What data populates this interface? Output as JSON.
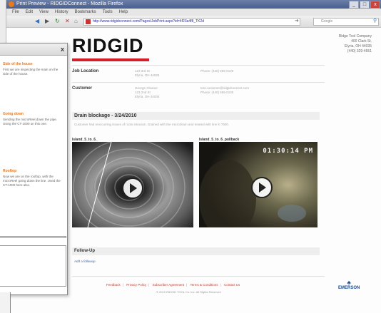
{
  "browser": {
    "title": "Print Preview - RIDGIDConnect - Mozilla Firefox",
    "menu": [
      "File",
      "Edit",
      "View",
      "History",
      "Bookmarks",
      "Tools",
      "Help"
    ],
    "url": "http://www.ridgidconnect.com/Pages/JobPrint.aspx?id=4f23a4f8_TK2d",
    "search_placeholder": "Google",
    "controls": {
      "minimize": "_",
      "maximize": "□",
      "close": "x"
    }
  },
  "page": {
    "logo": "RIDGID",
    "company_lines": [
      "Ridge Tool Company",
      "400 Clark St.",
      "Elyria, OH 44035",
      "(440) 329-4551"
    ],
    "job_location": {
      "label": "Job Location",
      "address": [
        "123 3rd St",
        "Elyria, OH 44035"
      ],
      "phone": "Phone: (440) 555-0100"
    },
    "customer": {
      "label": "Customer",
      "name_lines": [
        "George Cleaner",
        "123 2nd St",
        "Elyria, OH 44035"
      ],
      "email": "test.customer@ridgidconnect.com",
      "phone": "Phone: (440) 555-0100"
    },
    "section_title": "Drain blockage - 3/24/2010",
    "description": "Customer had reoccurring issues of roots intrusion. Drained with the microDrain and treated with line K-7500.",
    "videos": [
      {
        "label": "Island_5_to_6_",
        "timestamp": ""
      },
      {
        "label": "Island_5_to_6_pullback",
        "timestamp": "01:30:14 PM"
      }
    ],
    "followup": {
      "title": "Follow-Up",
      "add_link": "Add a followup"
    },
    "footer_links": [
      "Feedback",
      "Privacy Policy",
      "Subscriber Agreement",
      "Terms & Conditions",
      "Contact Us"
    ],
    "copyright": "© 2010 RIDGID TOOL Co. Inc. All Rights Reserved",
    "brand": "EMERSON"
  },
  "side_panel": {
    "close": "x",
    "notes": [
      {
        "title": "Side of the house",
        "body": "First we are inspecting the main on the side of the house."
      },
      {
        "title": "Going down",
        "body": "Sending the microReel down the pipe. Using the CT-1000 on this one."
      },
      {
        "title": "Rooftop",
        "body": "Now we are on the rooftop, with the microReel going down the line. Used the CT-1000 here also."
      }
    ]
  }
}
